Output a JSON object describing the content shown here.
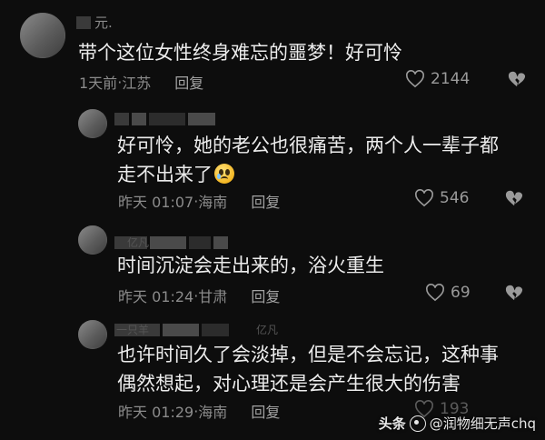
{
  "comments": [
    {
      "name": "元.",
      "text_lines": [
        "带个这位女性终身难忘的噩梦！好可怜"
      ],
      "time": "1天前",
      "location": "江苏",
      "reply_label": "回复",
      "likes": "2144"
    },
    {
      "name": "",
      "text_lines": [
        "好可怜，她的老公也很痛苦，两个人一辈子都",
        "走不出来了"
      ],
      "emoji_icon": "crying-face-emoji",
      "time": "昨天 01:07",
      "location": "海南",
      "reply_label": "回复",
      "likes": "546"
    },
    {
      "name": "亿凡",
      "text_lines": [
        "时间沉淀会走出来的，浴火重生"
      ],
      "time": "昨天 01:24",
      "location": "甘肃",
      "reply_label": "回复",
      "likes": "69"
    },
    {
      "name": "一只羊",
      "name2": "亿凡",
      "text_lines": [
        "也许时间久了会淡掉，但是不会忘记，这种事",
        "偶然想起，对心理还是会产生很大的伤害"
      ],
      "time": "昨天 01:29",
      "location": "海南",
      "reply_label": "回复",
      "likes": "193"
    }
  ],
  "separator": "·",
  "watermark": {
    "brand": "头条",
    "account": "@润物细无声chq"
  },
  "colors": {
    "background": "#0d0d0d",
    "text": "#ececec",
    "meta": "#8b8b8b"
  }
}
